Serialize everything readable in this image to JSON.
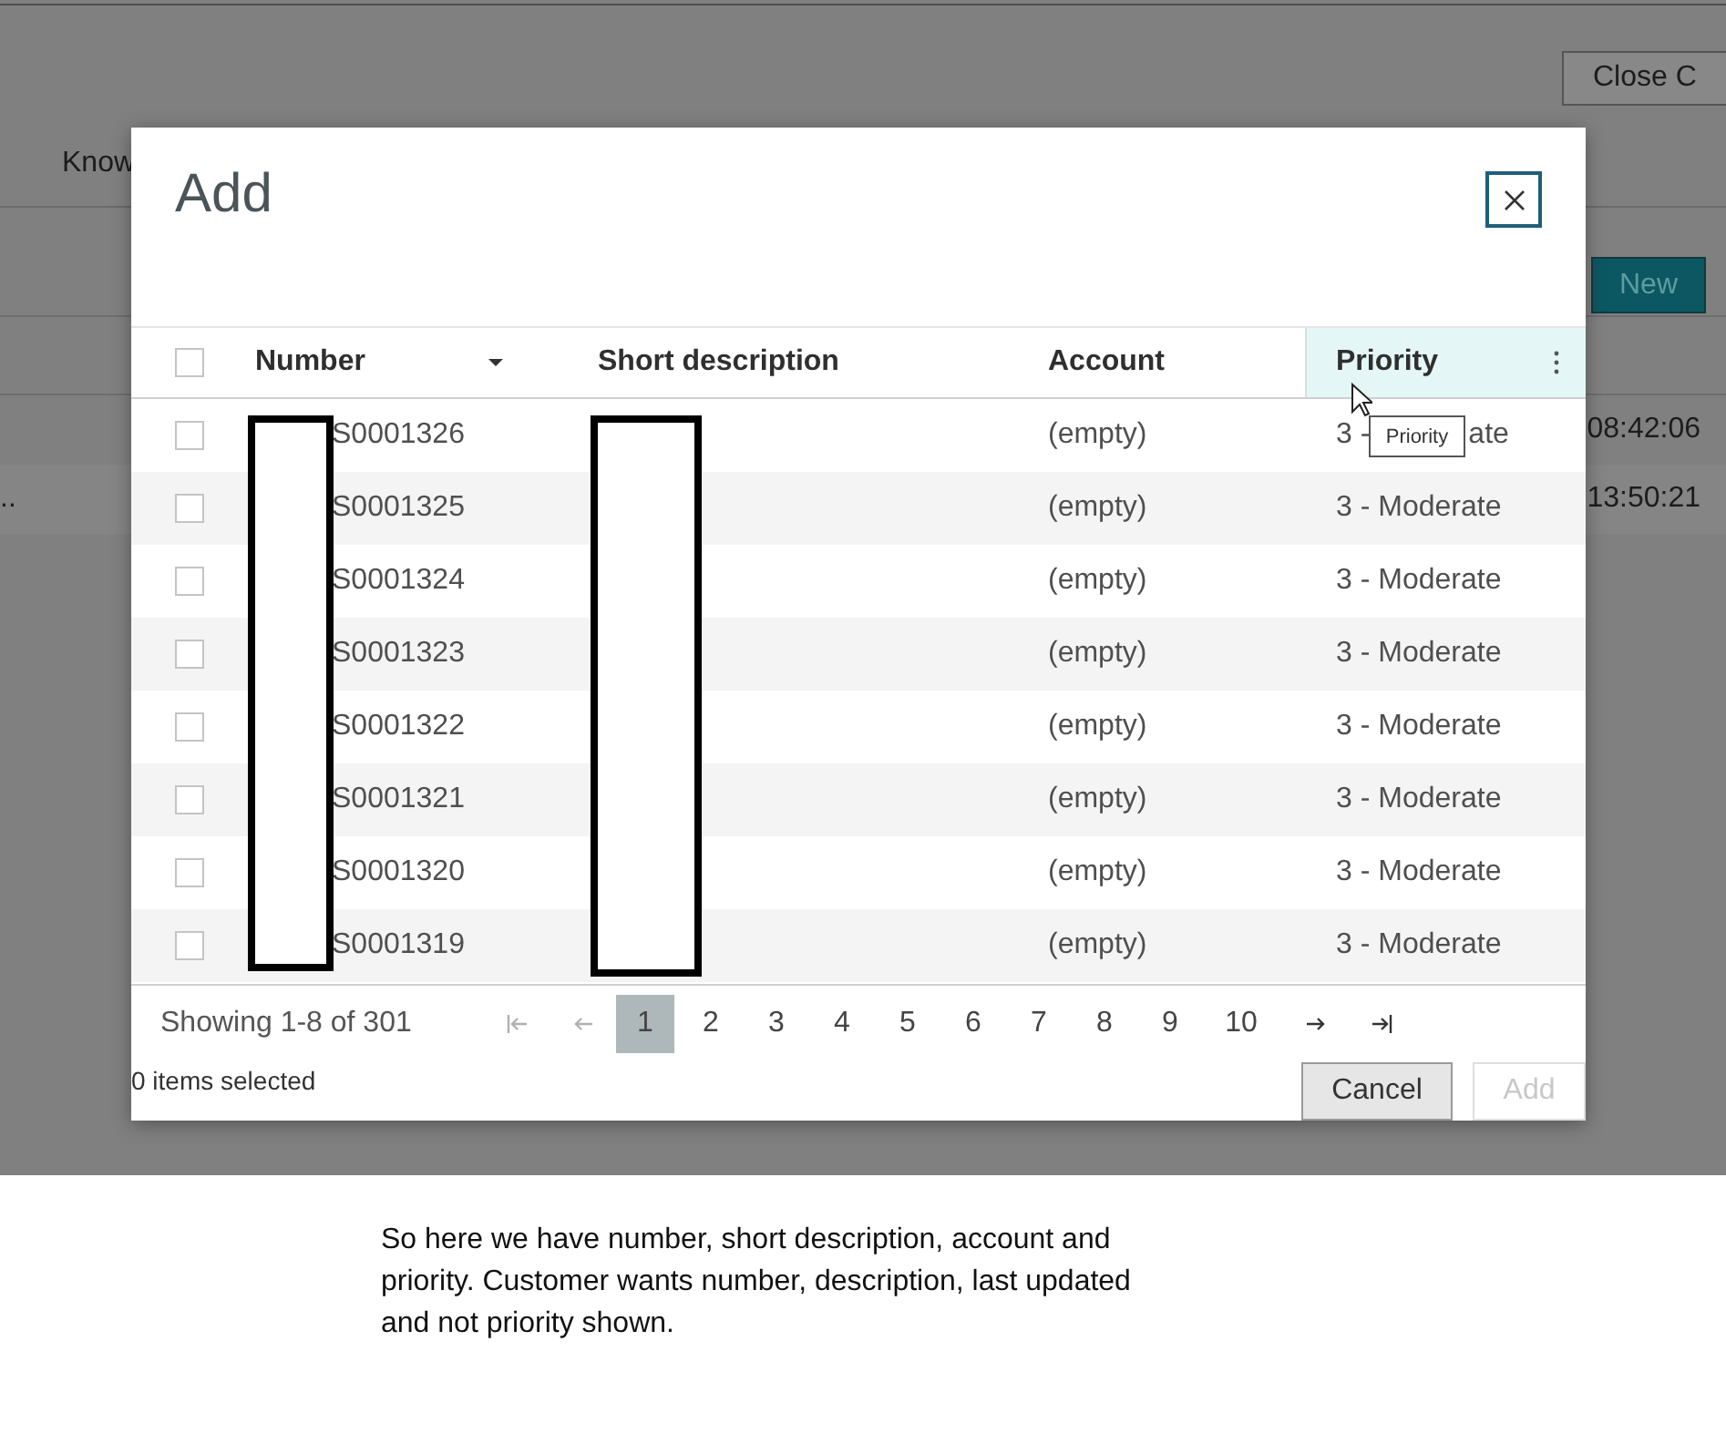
{
  "background": {
    "close_button": "Close C",
    "tabs": [
      "Know"
    ],
    "new_button": "New",
    "rows": [
      {
        "time": "08:42:06"
      },
      {
        "lead": "..",
        "time": "13:50:21"
      }
    ]
  },
  "dialog": {
    "title": "Add",
    "all_checked": false,
    "columns": [
      {
        "label": "Number",
        "sort_descending": true,
        "redacted": true
      },
      {
        "label": "Short description",
        "redacted": true
      },
      {
        "label": "Account"
      },
      {
        "label": "Priority",
        "highlighted": true,
        "menu": true
      }
    ],
    "tooltip": "Priority",
    "rows": [
      {
        "checked": false,
        "number": "S0001326",
        "account": "(empty)",
        "priority": "3 -",
        "priority_tail": "ate"
      },
      {
        "checked": false,
        "number": "S0001325",
        "account": "(empty)",
        "priority": "3 - Moderate"
      },
      {
        "checked": false,
        "number": "S0001324",
        "account": "(empty)",
        "priority": "3 - Moderate"
      },
      {
        "checked": false,
        "number": "S0001323",
        "account": "(empty)",
        "priority": "3 - Moderate"
      },
      {
        "checked": false,
        "number": "S0001322",
        "account": "(empty)",
        "priority": "3 - Moderate"
      },
      {
        "checked": false,
        "number": "S0001321",
        "account": "(empty)",
        "priority": "3 - Moderate"
      },
      {
        "checked": false,
        "number": "S0001320",
        "account": "(empty)",
        "priority": "3 - Moderate"
      },
      {
        "checked": false,
        "number": "S0001319",
        "account": "(empty)",
        "priority": "3 - Moderate"
      }
    ],
    "pagination": {
      "summary": "Showing 1-8 of 301",
      "nav_before": [
        {
          "kind": "first",
          "disabled": true
        },
        {
          "kind": "prev",
          "disabled": true
        }
      ],
      "pages": [
        {
          "label": "1",
          "selected": true
        },
        {
          "label": "2",
          "selected": false
        },
        {
          "label": "3",
          "selected": false
        },
        {
          "label": "4",
          "selected": false
        },
        {
          "label": "5",
          "selected": false
        },
        {
          "label": "6",
          "selected": false
        },
        {
          "label": "7",
          "selected": false
        },
        {
          "label": "8",
          "selected": false
        },
        {
          "label": "9",
          "selected": false
        },
        {
          "label": "10",
          "selected": false
        }
      ],
      "nav_after": [
        {
          "kind": "next",
          "disabled": false
        },
        {
          "kind": "last",
          "disabled": false
        }
      ]
    },
    "selection": "0 items selected",
    "buttons": [
      {
        "label": "Cancel",
        "disabled": false
      },
      {
        "label": "Add",
        "disabled": true
      }
    ]
  },
  "note": "So here we have number, short description, account and priority. Customer wants number, description, last updated and not priority shown."
}
